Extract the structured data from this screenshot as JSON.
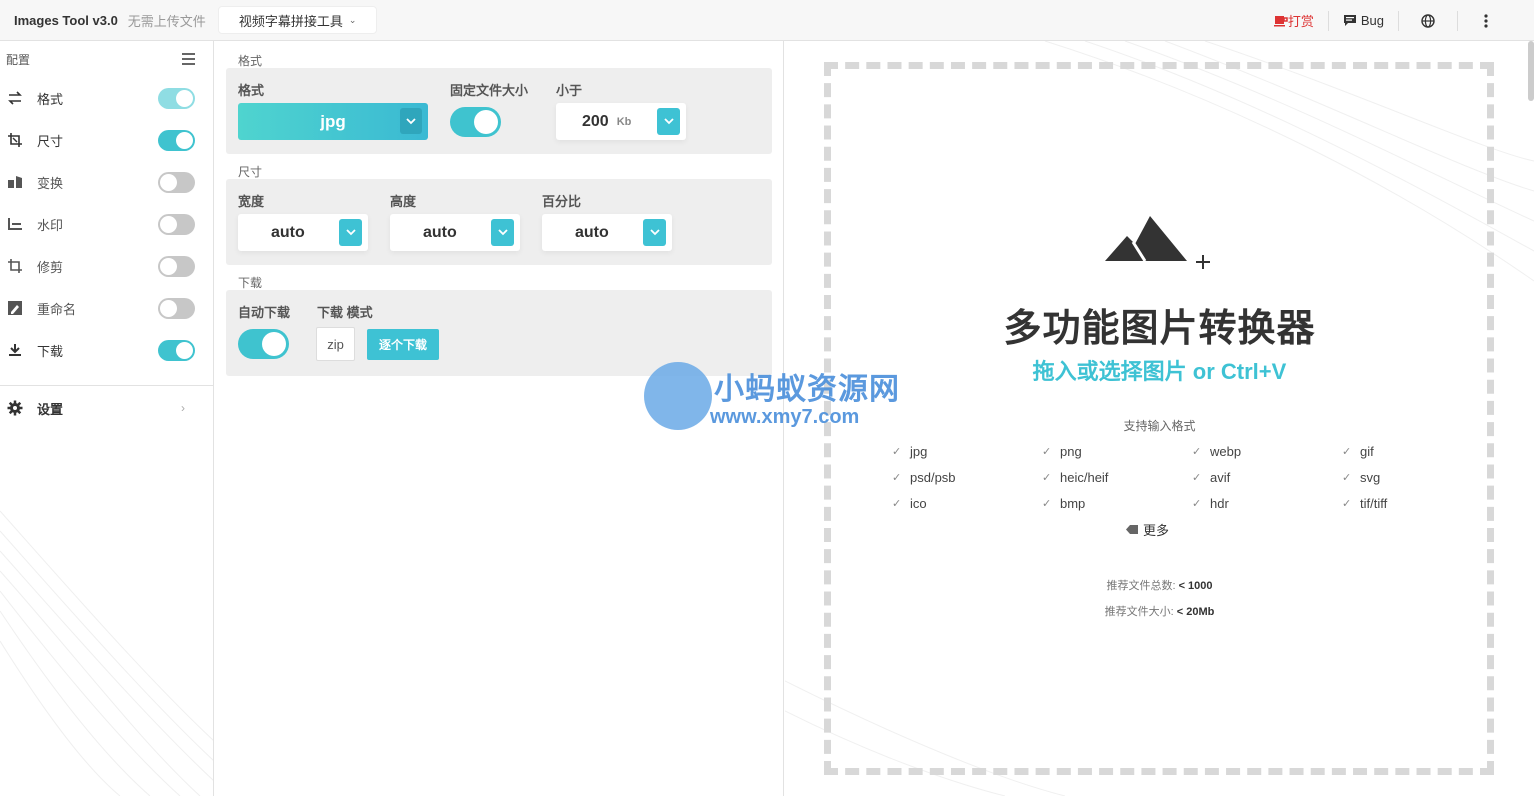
{
  "topbar": {
    "title": "Images Tool v3.0",
    "subtitle": "无需上传文件",
    "tool_select": "视频字幕拼接工具",
    "donate": "打赏",
    "bug": "Bug"
  },
  "sidebar": {
    "header": "配置",
    "items": [
      {
        "label": "格式",
        "icon": "swap-icon",
        "state": "on-light"
      },
      {
        "label": "尺寸",
        "icon": "crop-resize-icon",
        "state": "on"
      },
      {
        "label": "变换",
        "icon": "transform-icon",
        "state": "off"
      },
      {
        "label": "水印",
        "icon": "watermark-icon",
        "state": "off"
      },
      {
        "label": "修剪",
        "icon": "crop-icon",
        "state": "off"
      },
      {
        "label": "重命名",
        "icon": "rename-icon",
        "state": "off"
      },
      {
        "label": "下载",
        "icon": "download-icon",
        "state": "on"
      }
    ],
    "settings": "设置"
  },
  "format_section": {
    "title": "格式",
    "format_label": "格式",
    "format_value": "jpg",
    "fixed_size_label": "固定文件大小",
    "fixed_size_on": true,
    "less_than_label": "小于",
    "less_than_value": "200",
    "less_than_unit": "Kb"
  },
  "size_section": {
    "title": "尺寸",
    "width_label": "宽度",
    "width_value": "auto",
    "height_label": "高度",
    "height_value": "auto",
    "percent_label": "百分比",
    "percent_value": "auto"
  },
  "download_section": {
    "title": "下载",
    "auto_label": "自动下载",
    "auto_on": true,
    "mode_label": "下载 模式",
    "zip_label": "zip",
    "each_label": "逐个下载"
  },
  "dropzone": {
    "title": "多功能图片转换器",
    "subtitle": "拖入或选择图片 or Ctrl+V",
    "formats_heading": "支持输入格式",
    "formats": [
      "jpg",
      "png",
      "webp",
      "gif",
      "psd/psb",
      "heic/heif",
      "avif",
      "svg",
      "ico",
      "bmp",
      "hdr",
      "tif/tiff"
    ],
    "more": "更多",
    "rec_count_label": "推荐文件总数:",
    "rec_count_value": "< 1000",
    "rec_size_label": "推荐文件大小:",
    "rec_size_value": "< 20Mb"
  },
  "watermark": {
    "line1": "小蚂蚁资源网",
    "line2": "www.xmy7.com"
  },
  "colors": {
    "accent": "#3ec2d4",
    "toggle_off": "#c7c7c7",
    "donate": "#dd3333"
  }
}
